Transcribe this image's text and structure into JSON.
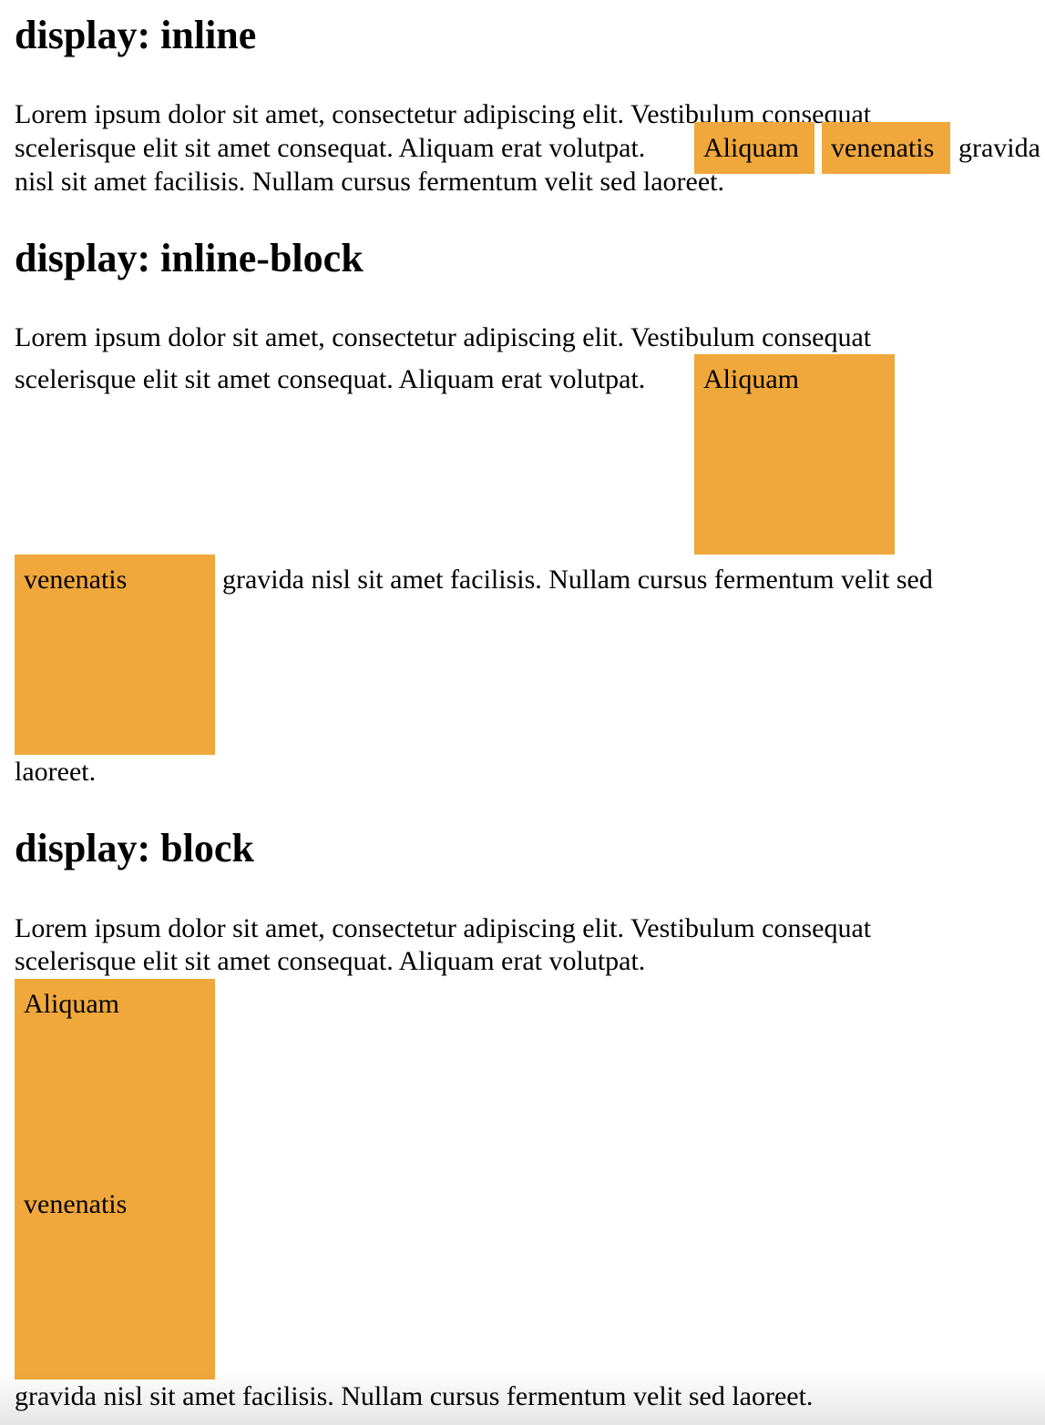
{
  "sections": [
    {
      "heading": "display: inline",
      "line1": "Lorem ipsum dolor sit amet, consectetur adipiscing elit. Vestibulum consequat",
      "line2_pre": "scelerisque elit sit amet consequat. Aliquam erat volutpat.",
      "box1": "Aliquam",
      "box2": "venenatis",
      "line2_post": "gravida",
      "line3": "nisl sit amet facilisis. Nullam cursus fermentum velit sed laoreet."
    },
    {
      "heading": "display: inline-block",
      "line1": "Lorem ipsum dolor sit amet, consectetur adipiscing elit. Vestibulum consequat",
      "line2_pre": "scelerisque elit sit amet consequat. Aliquam erat volutpat.",
      "box1": "Aliquam",
      "box2": "venenatis",
      "line3_post": "gravida nisl sit amet facilisis. Nullam cursus fermentum velit sed",
      "line4": "laoreet."
    },
    {
      "heading": "display: block",
      "line1": "Lorem ipsum dolor sit amet, consectetur adipiscing elit. Vestibulum consequat",
      "line2": "scelerisque elit sit amet consequat. Aliquam erat volutpat.",
      "box1": "Aliquam",
      "box2": "venenatis",
      "line_after": "gravida nisl sit amet facilisis. Nullam cursus fermentum velit sed laoreet."
    }
  ],
  "colors": {
    "box_background": "#f0a83c",
    "text": "#000000",
    "background": "#ffffff"
  }
}
